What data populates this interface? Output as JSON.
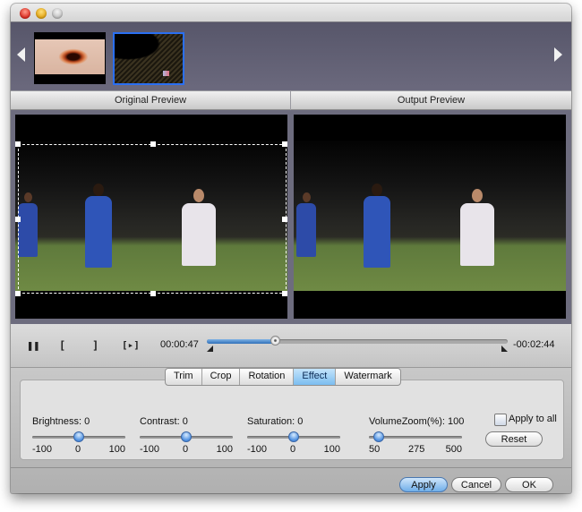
{
  "window": {
    "controls": [
      "close",
      "minimize",
      "zoom"
    ]
  },
  "thumbnails": {
    "prev_icon": "triangle-left-icon",
    "next_icon": "triangle-right-icon",
    "items": [
      {
        "name": "lips-clip",
        "selected": false
      },
      {
        "name": "stadium-clip",
        "selected": true
      }
    ]
  },
  "previews": {
    "original_label": "Original Preview",
    "output_label": "Output Preview"
  },
  "playback": {
    "pause_glyph": "❚❚",
    "mark_in_glyph": "[",
    "mark_out_glyph": "]",
    "play_selection_glyph": "[▸]",
    "elapsed": "00:00:47",
    "remaining": "-00:02:44",
    "progress_fraction": 0.23
  },
  "tabs": {
    "items": [
      "Trim",
      "Crop",
      "Rotation",
      "Effect",
      "Watermark"
    ],
    "active": "Effect"
  },
  "effect": {
    "brightness": {
      "label": "Brightness:",
      "value": "0",
      "min": "-100",
      "mid": "0",
      "max": "100",
      "fraction": 0.5
    },
    "contrast": {
      "label": "Contrast:",
      "value": "0",
      "min": "-100",
      "mid": "0",
      "max": "100",
      "fraction": 0.5
    },
    "saturation": {
      "label": "Saturation:",
      "value": "0",
      "min": "-100",
      "mid": "0",
      "max": "100",
      "fraction": 0.5
    },
    "volume": {
      "label": "VolumeZoom(%):",
      "value": "100",
      "min": "50",
      "mid": "275",
      "max": "500",
      "fraction": 0.11
    },
    "apply_to_all_label": "Apply to all",
    "apply_to_all_checked": false,
    "reset_label": "Reset"
  },
  "footer": {
    "apply_label": "Apply",
    "cancel_label": "Cancel",
    "ok_label": "OK"
  },
  "colors": {
    "accent_blue": "#2a6ff2",
    "strip_bg": "#5f5e72",
    "active_tab": "#7bbdf0"
  }
}
